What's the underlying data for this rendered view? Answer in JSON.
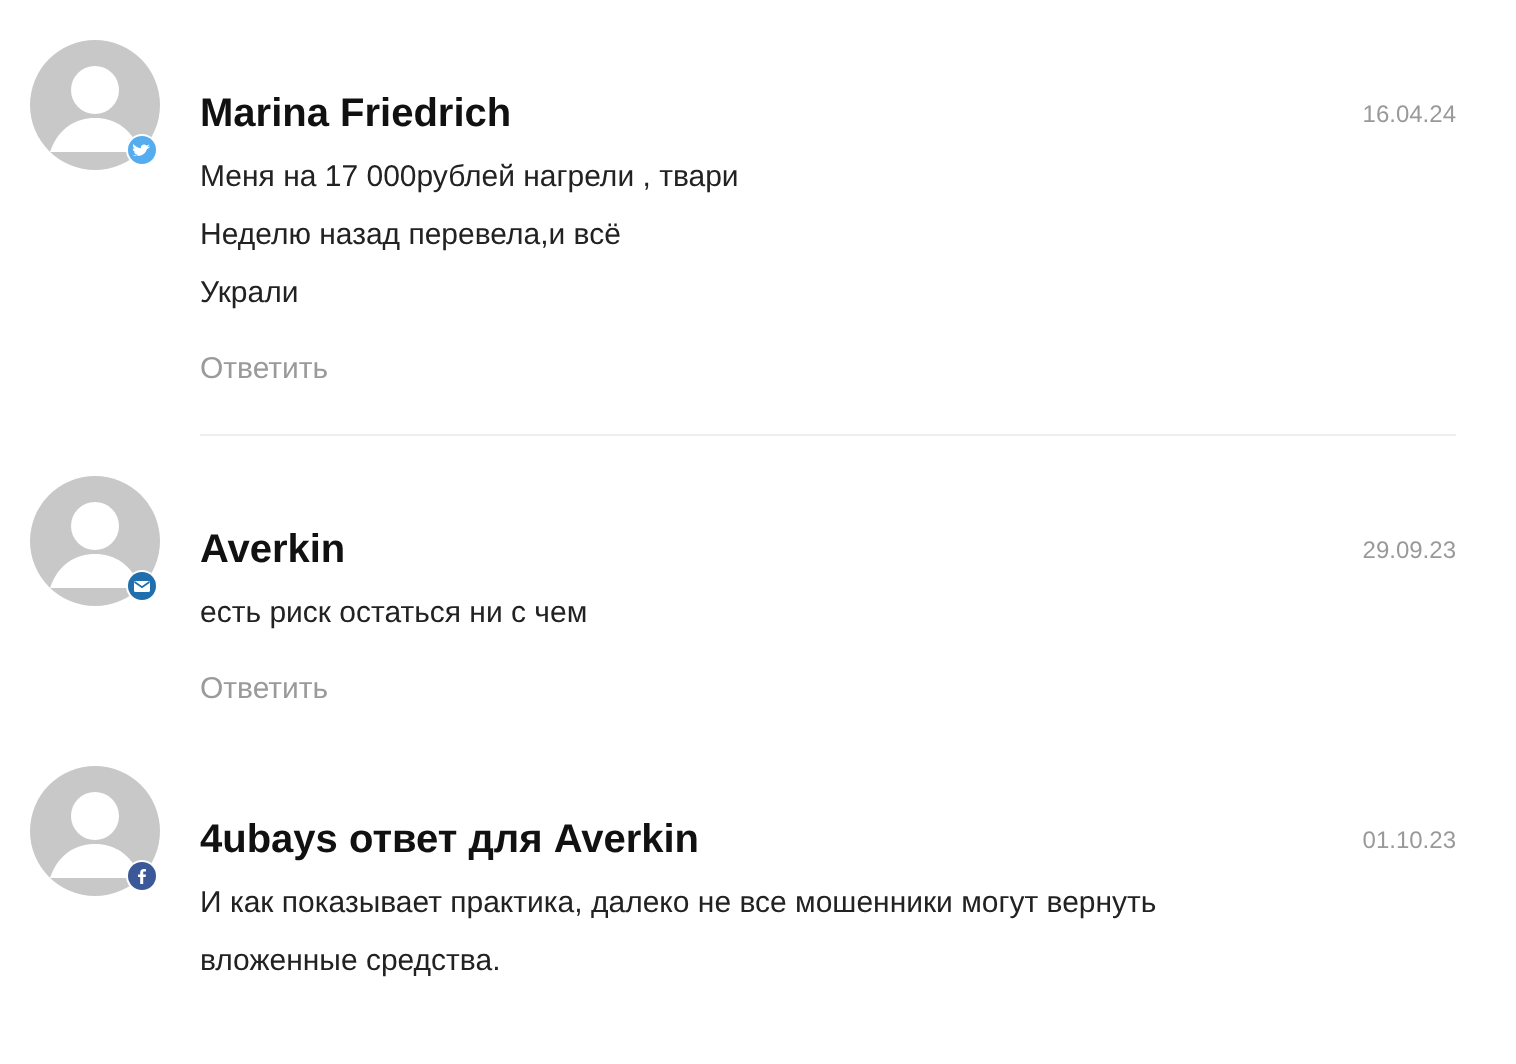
{
  "comments": [
    {
      "author": "Marina Friedrich",
      "date": "16.04.24",
      "kind": "twitter",
      "lines": [
        "Меня на 17 000рублей нагрели , твари",
        "Неделю назад перевела,и всё",
        "Украли"
      ],
      "reply": "Ответить",
      "separated": true
    },
    {
      "author": "Averkin",
      "date": "29.09.23",
      "kind": "email",
      "lines": [
        "есть риск остаться ни с чем"
      ],
      "reply": "Ответить",
      "separated": false
    },
    {
      "author": "4ubays ответ для Averkin",
      "date": "01.10.23",
      "kind": "facebook",
      "lines": [
        "И как показывает практика, далеко не все мошенники могут вернуть вложенные средства."
      ]
    }
  ]
}
